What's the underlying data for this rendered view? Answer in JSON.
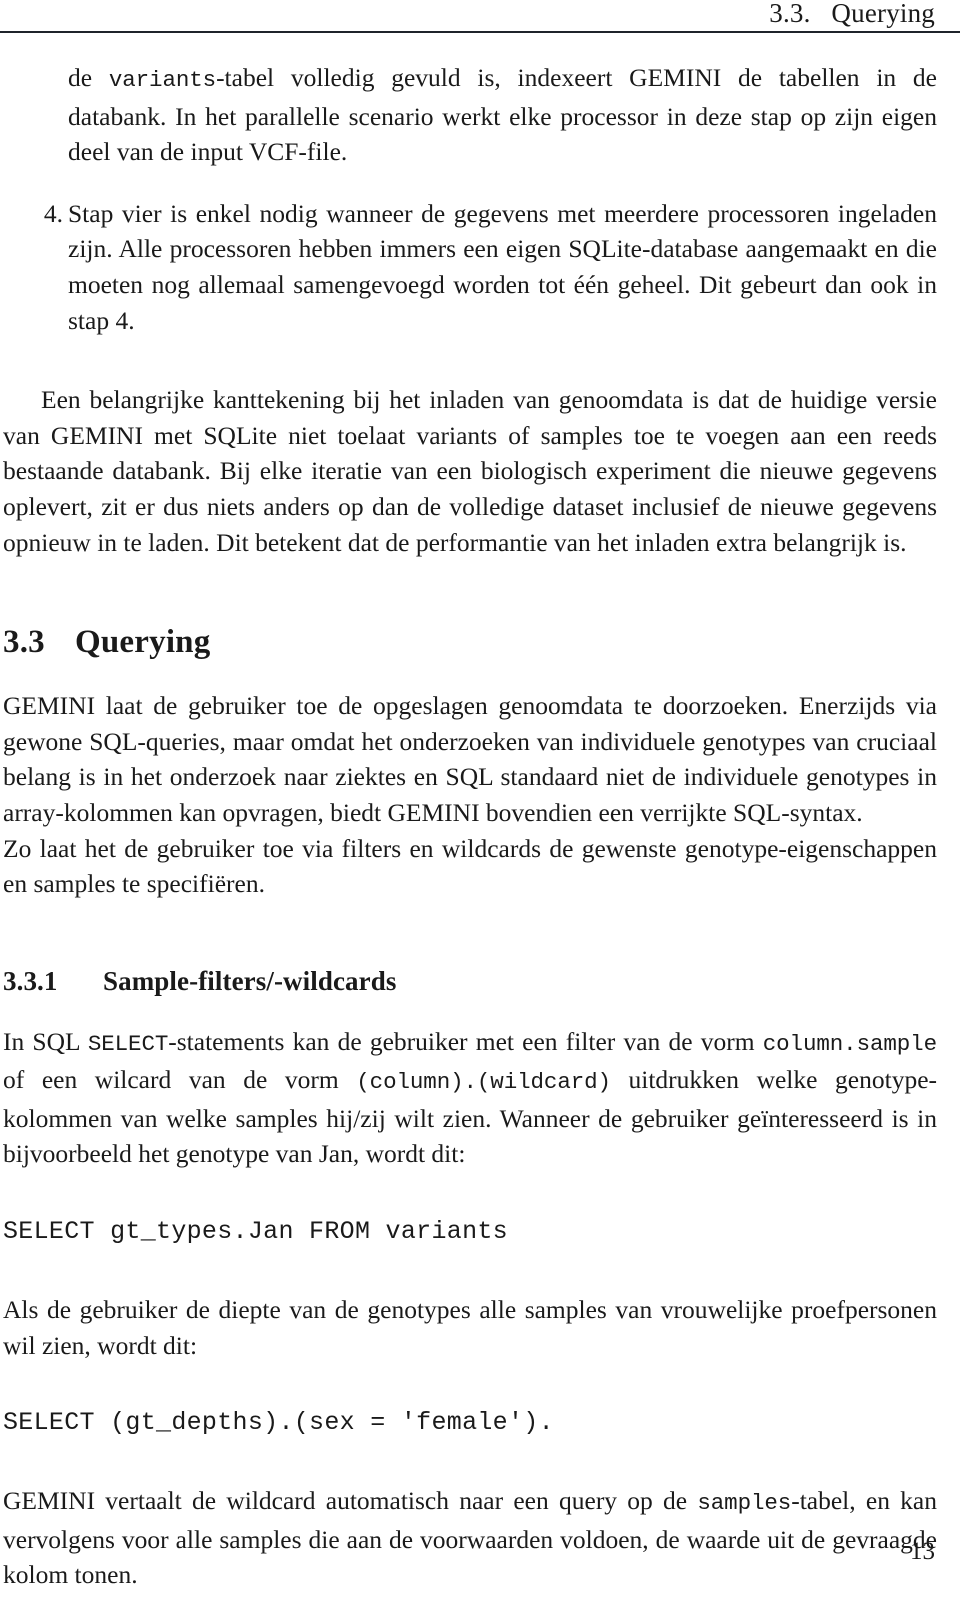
{
  "header": {
    "title": "3.3.   Querying"
  },
  "body": {
    "list_continuation": {
      "before_code": "de ",
      "code": "variants",
      "after_code": "-tabel volledig gevuld is, indexeert GEMINI de tabellen in de databank. In het parallelle scenario werkt elke processor in deze stap op zijn eigen deel van de input VCF-file."
    },
    "list_items": [
      {
        "marker": "4.",
        "text": "Stap vier is enkel nodig wanneer de gegevens met meerdere processoren ingeladen zijn.  Alle processoren hebben immers een eigen SQLite-database aangemaakt en die moeten nog allemaal samengevoegd worden tot één geheel. Dit gebeurt dan ook in stap 4."
      }
    ],
    "paragraph_kanttekening": "Een belangrijke kanttekening bij het inladen van genoomdata is dat de huidige versie van GEMINI met SQLite niet toelaat variants of samples toe te voegen aan een reeds bestaande databank.  Bij elke iteratie van een biologisch experiment die nieuwe gegevens oplevert, zit er dus niets anders op dan de volledige dataset inclusief de nieuwe gegevens opnieuw in te laden.  Dit betekent dat de performantie van het inladen extra belangrijk is."
  },
  "section": {
    "number": "3.3",
    "title": "Querying",
    "paragraph_1": "GEMINI laat de gebruiker toe de opgeslagen genoomdata te doorzoeken.  Enerzijds via gewone SQL-queries, maar omdat het onderzoeken van individuele genotypes van cruciaal belang is in het onderzoek naar ziektes en SQL standaard niet de individuele genotypes in array-kolommen kan opvragen, biedt GEMINI bovendien een verrijkte SQL-syntax.",
    "paragraph_2": "Zo laat het de gebruiker toe via filters en wildcards de gewenste genotype-eigenschappen en samples te specifiëren."
  },
  "subsection": {
    "number": "3.3.1",
    "title": "Sample-filters/-wildcards",
    "paragraph_1": {
      "part_1": "In SQL ",
      "code_1": "SELECT",
      "part_2": "-statements kan de gebruiker met een filter van de vorm ",
      "code_2": "column.sample",
      "part_3": " of een wilcard van de vorm ",
      "code_3": "(column).(wildcard)",
      "part_4": " uitdrukken welke genotype-kolommen van welke samples hij/zij wilt zien.  Wanneer de gebruiker geïnteresseerd is in bijvoorbeeld het genotype van Jan, wordt dit:"
    },
    "code_1": "SELECT gt_types.Jan FROM variants",
    "paragraph_2": "Als de gebruiker de diepte van de genotypes alle samples van vrouwelijke proefpersonen wil zien, wordt dit:",
    "code_2": "SELECT (gt_depths).(sex = 'female').",
    "paragraph_3": {
      "part_1": "GEMINI vertaalt de wildcard automatisch naar een query op de ",
      "code_1": "samples",
      "part_2": "-tabel, en kan vervolgens voor alle samples die aan de voorwaarden voldoen, de waarde uit de gevraagde kolom tonen."
    }
  },
  "footer": {
    "page_number": "13"
  }
}
